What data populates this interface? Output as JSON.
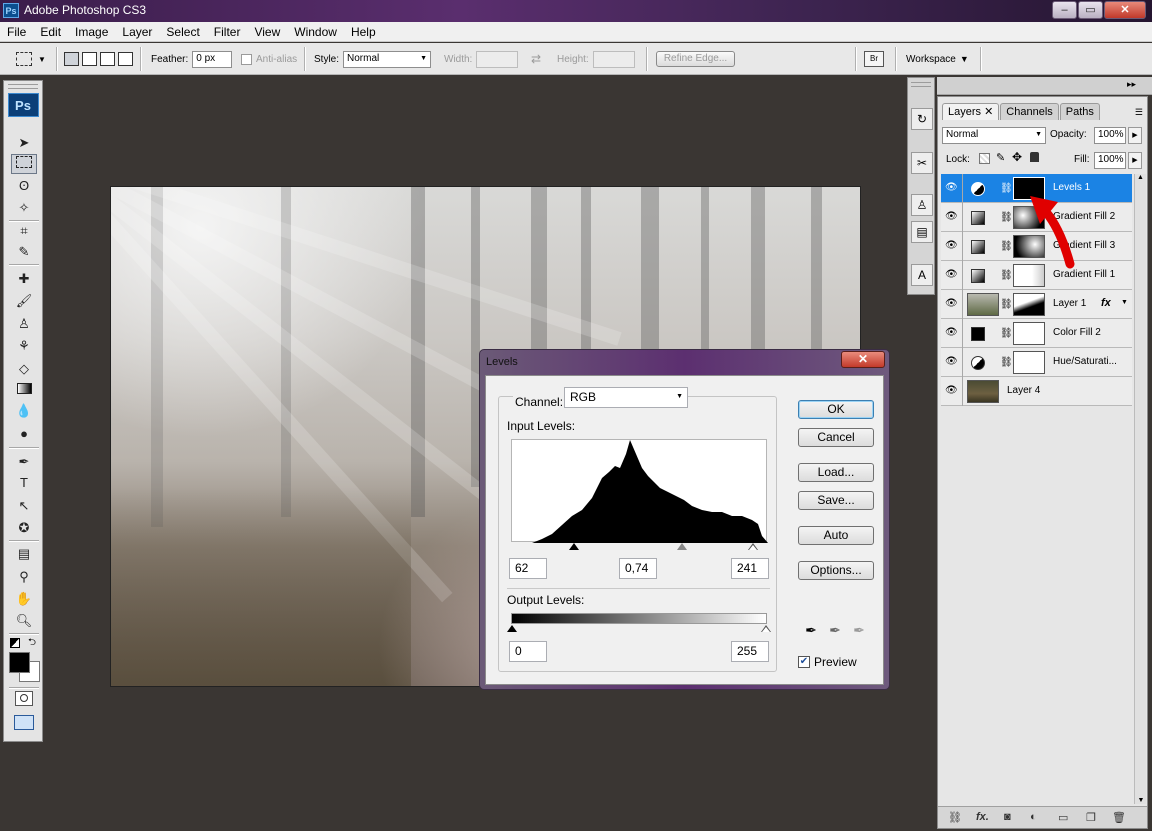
{
  "window": {
    "title": "Adobe Photoshop CS3",
    "ps_badge": "Ps",
    "min": "‒",
    "max": "▭",
    "close": "✕"
  },
  "menu": [
    "File",
    "Edit",
    "Image",
    "Layer",
    "Select",
    "Filter",
    "View",
    "Window",
    "Help"
  ],
  "options": {
    "feather_label": "Feather:",
    "feather_value": "0 px",
    "antialias_label": "Anti-alias",
    "style_label": "Style:",
    "style_value": "Normal",
    "width_label": "Width:",
    "height_label": "Height:",
    "refine_edge": "Refine Edge...",
    "workspace": "Workspace"
  },
  "tools": {
    "logo": "Ps"
  },
  "levels": {
    "title": "Levels",
    "close": "✕",
    "channel_label": "Channel:",
    "channel_value": "RGB",
    "input_label": "Input Levels:",
    "input_black": "62",
    "input_mid": "0,74",
    "input_white": "241",
    "output_label": "Output Levels:",
    "output_black": "0",
    "output_white": "255",
    "buttons": {
      "ok": "OK",
      "cancel": "Cancel",
      "load": "Load...",
      "save": "Save...",
      "auto": "Auto",
      "options": "Options..."
    },
    "preview_label": "Preview",
    "preview_checked": true
  },
  "layers_panel": {
    "tabs": [
      {
        "label": "Layers ✕"
      },
      {
        "label": "Channels"
      },
      {
        "label": "Paths"
      }
    ],
    "blend_mode": "Normal",
    "opacity_label": "Opacity:",
    "opacity_value": "100%",
    "lock_label": "Lock:",
    "fill_label": "Fill:",
    "fill_value": "100%",
    "layers": [
      {
        "name": "Levels 1",
        "selected": true
      },
      {
        "name": "Gradient Fill 2",
        "selected": false
      },
      {
        "name": "Gradient Fill 3",
        "selected": false
      },
      {
        "name": "Gradient Fill 1",
        "selected": false
      },
      {
        "name": "Layer 1",
        "selected": false,
        "fx": "fx"
      },
      {
        "name": "Color Fill 2",
        "selected": false
      },
      {
        "name": "Hue/Saturati...",
        "selected": false
      },
      {
        "name": "Layer 4",
        "selected": false
      }
    ]
  },
  "colors": {
    "accent": "#1b83e4",
    "arrow": "#e00000",
    "title_bar": "#5a2e6e"
  }
}
